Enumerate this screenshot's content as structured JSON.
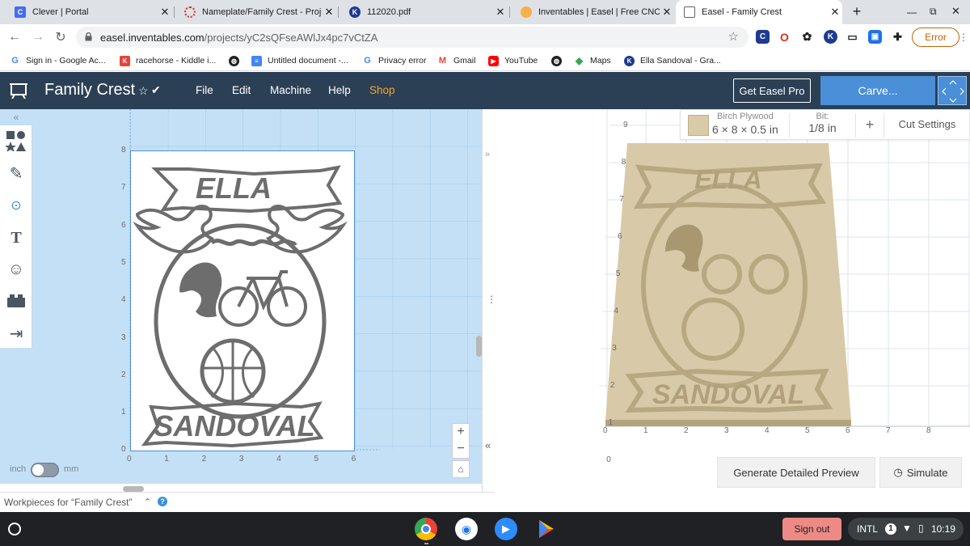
{
  "tabs": [
    {
      "title": "Clever | Portal",
      "icon": "clever-icon",
      "color": "#436cf2"
    },
    {
      "title": "Nameplate/Family Crest - Proje",
      "icon": "project-icon",
      "color": "#d93025"
    },
    {
      "title": "112020.pdf",
      "icon": "kami-icon",
      "color": "#1f3a93"
    },
    {
      "title": "Inventables | Easel | Free CNC S",
      "icon": "inventables-icon",
      "color": "#f4a02c"
    },
    {
      "title": "Easel - Family Crest",
      "icon": "easel-icon",
      "color": "#5f6368"
    }
  ],
  "url": {
    "host": "easel.inventables.com",
    "path": "/projects/yC2sQFseAWlJx4pc7vCtZA"
  },
  "toolbar": {
    "error_label": "Error"
  },
  "bookmarks": [
    {
      "label": "Sign in - Google Ac...",
      "icon": "google-icon",
      "color": "#4285f4",
      "glyph": "G"
    },
    {
      "label": "racehorse - Kiddle i...",
      "icon": "kiddle-icon",
      "color": "#e94235",
      "glyph": "K"
    },
    {
      "label": "",
      "icon": "globe-icon",
      "color": "#202124",
      "glyph": "◍"
    },
    {
      "label": "Untitled document -...",
      "icon": "docs-icon",
      "color": "#4285f4",
      "glyph": "≡"
    },
    {
      "label": "Privacy error",
      "icon": "google-icon",
      "color": "#4285f4",
      "glyph": "G"
    },
    {
      "label": "Gmail",
      "icon": "gmail-icon",
      "color": "#ea4335",
      "glyph": "M"
    },
    {
      "label": "YouTube",
      "icon": "youtube-icon",
      "color": "#ff0000",
      "glyph": "▶"
    },
    {
      "label": "",
      "icon": "globe-icon",
      "color": "#202124",
      "glyph": "◍"
    },
    {
      "label": "Maps",
      "icon": "maps-icon",
      "color": "#34a853",
      "glyph": "◆"
    },
    {
      "label": "Ella Sandoval - Gra...",
      "icon": "kami-icon",
      "color": "#1f3a93",
      "glyph": "K"
    }
  ],
  "easel": {
    "project_title": "Family Crest",
    "menu": [
      "File",
      "Edit",
      "Machine",
      "Help",
      "Shop"
    ],
    "get_pro_label": "Get Easel Pro",
    "carve_label": "Carve...",
    "material": {
      "name": "Birch Plywood",
      "size": "6 × 8 × 0.5 in"
    },
    "bit": {
      "label": "Bit:",
      "value": "1/8 in"
    },
    "cut_settings_label": "Cut Settings",
    "design": {
      "top_name": "ELLA",
      "bottom_name": "SANDOVAL"
    },
    "left_y_ticks": [
      "8",
      "7",
      "6",
      "5",
      "4",
      "3",
      "2",
      "1",
      "0"
    ],
    "left_x_ticks": [
      "0",
      "1",
      "2",
      "3",
      "4",
      "5",
      "6"
    ],
    "right_y_ticks": [
      "9",
      "8",
      "7",
      "6",
      "5",
      "4",
      "3",
      "2",
      "1",
      "0"
    ],
    "right_x_ticks": [
      "0",
      "1",
      "2",
      "3",
      "4",
      "5",
      "6",
      "7",
      "8"
    ],
    "units": {
      "left": "inch",
      "right": "mm"
    },
    "generate_preview_label": "Generate Detailed Preview",
    "simulate_label": "Simulate",
    "workpieces_label": "Workpieces for “Family Crest”"
  },
  "taskbar": {
    "sign_out_label": "Sign out",
    "keyboard": "INTL",
    "notif_count": "1",
    "time": "10:19"
  }
}
